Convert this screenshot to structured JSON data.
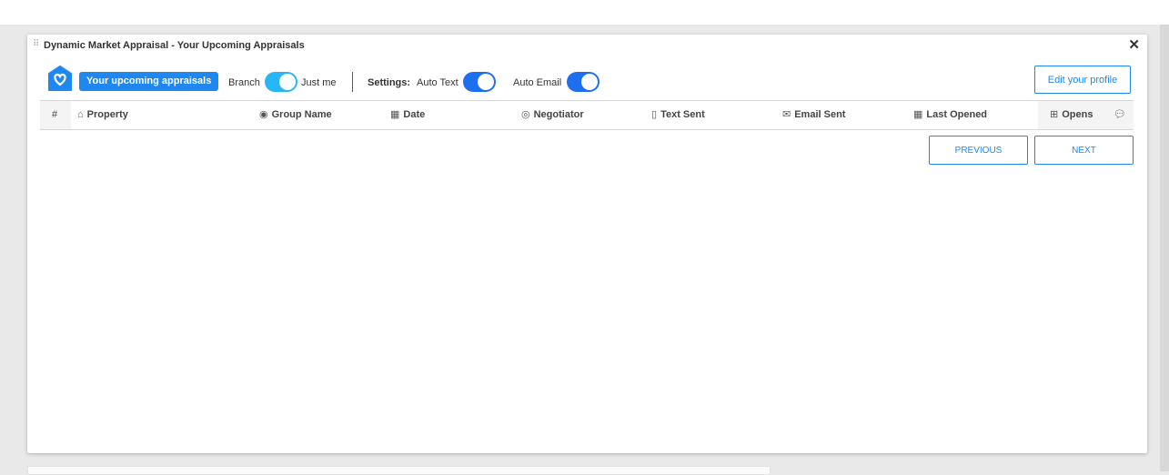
{
  "panel": {
    "title": "Dynamic Market Appraisal - Your Upcoming Appraisals",
    "close_icon": "close-icon",
    "drag_icon": "drag-handle-icon"
  },
  "toolbar": {
    "brand_icon": "home-heart-icon",
    "upcoming_label": "Your upcoming appraisals",
    "branch_label": "Branch",
    "just_me_label": "Just me",
    "branch_toggle_on": true,
    "settings_label": "Settings:",
    "auto_text_label": "Auto Text",
    "auto_text_on": true,
    "auto_email_label": "Auto Email",
    "auto_email_on": true,
    "edit_profile_label": "Edit your profile"
  },
  "table": {
    "columns": [
      {
        "key": "number",
        "label": "#",
        "icon": ""
      },
      {
        "key": "property",
        "label": "Property",
        "icon": "home-icon"
      },
      {
        "key": "group_name",
        "label": "Group Name",
        "icon": "user-circle-icon"
      },
      {
        "key": "date",
        "label": "Date",
        "icon": "calendar-icon"
      },
      {
        "key": "negotiator",
        "label": "Negotiator",
        "icon": "user-icon"
      },
      {
        "key": "text_sent",
        "label": "Text Sent",
        "icon": "mobile-icon"
      },
      {
        "key": "email_sent",
        "label": "Email Sent",
        "icon": "envelope-icon"
      },
      {
        "key": "last_opened",
        "label": "Last Opened",
        "icon": "calendar-icon"
      },
      {
        "key": "opens",
        "label": "Opens",
        "icon": "grid-icon"
      },
      {
        "key": "comments",
        "label": "",
        "icon": "comment-icon"
      }
    ],
    "rows": []
  },
  "pagination": {
    "previous_label": "PREVIOUS",
    "next_label": "NEXT"
  },
  "colors": {
    "accent": "#1e88f0",
    "toggle_branch": "#29b6f6",
    "toggle_blue": "#1e6ff0"
  }
}
